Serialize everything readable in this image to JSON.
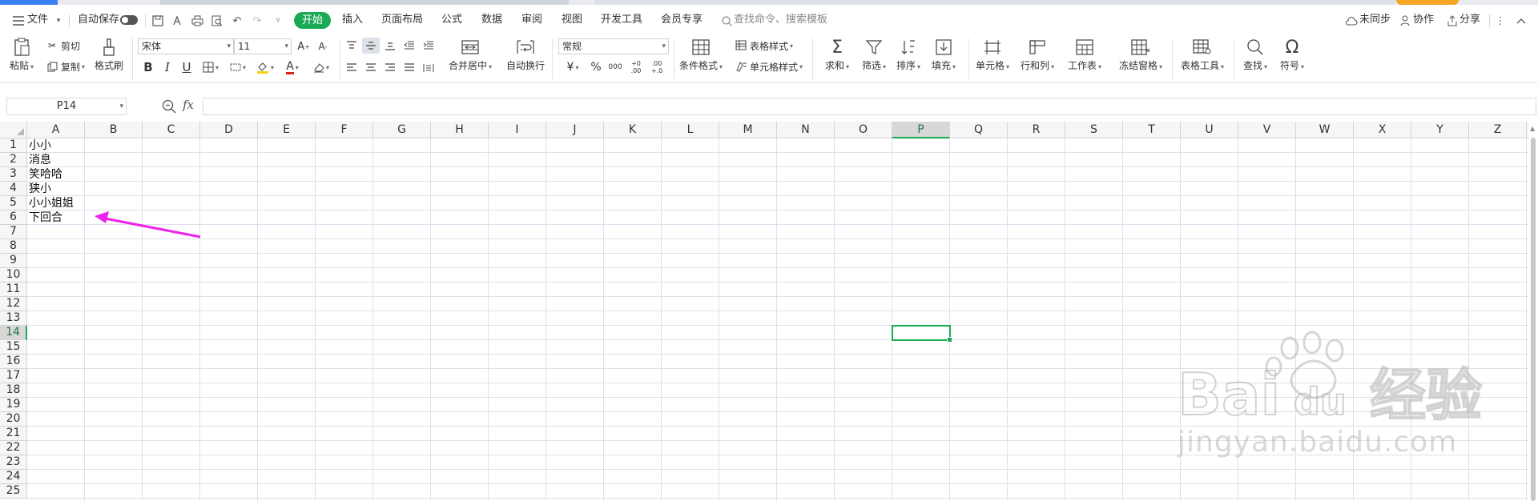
{
  "menubar": {
    "file_label": "文件",
    "autosave_label": "自动保存",
    "tabs": [
      "开始",
      "插入",
      "页面布局",
      "公式",
      "数据",
      "审阅",
      "视图",
      "开发工具",
      "会员专享"
    ],
    "search_placeholder": "查找命令、搜索模板",
    "sync_label": "未同步",
    "collab_label": "协作",
    "share_label": "分享"
  },
  "ribbon": {
    "paste": "粘贴",
    "cut": "剪切",
    "copy": "复制",
    "format_painter": "格式刷",
    "font_name": "宋体",
    "font_size": "11",
    "bold": "B",
    "italic": "I",
    "underline": "U",
    "merge_center": "合并居中",
    "wrap_text": "自动换行",
    "number_format": "常规",
    "currency": "¥",
    "percent": "%",
    "thousands": "000",
    "inc_decimal": "+0 .00",
    "dec_decimal": ".00 +.0",
    "cond_format": "条件格式",
    "table_style": "表格样式",
    "cell_style": "单元格样式",
    "sum": "求和",
    "filter": "筛选",
    "sort": "排序",
    "fill": "填充",
    "cell": "单元格",
    "row_col": "行和列",
    "worksheet": "工作表",
    "freeze": "冻结窗格",
    "table_tools": "表格工具",
    "find": "查找",
    "symbol": "符号"
  },
  "formula_bar": {
    "name_box": "P14",
    "fx": "fx",
    "content": ""
  },
  "sheet": {
    "columns": [
      "A",
      "B",
      "C",
      "D",
      "E",
      "F",
      "G",
      "H",
      "I",
      "J",
      "K",
      "L",
      "M",
      "N",
      "O",
      "P",
      "Q",
      "R",
      "S",
      "T",
      "U",
      "V",
      "W",
      "X",
      "Y",
      "Z"
    ],
    "rows": [
      "1",
      "2",
      "3",
      "4",
      "5",
      "6",
      "7",
      "8",
      "9",
      "10",
      "11",
      "12",
      "13",
      "14",
      "15",
      "16",
      "17",
      "18",
      "19",
      "20",
      "21",
      "22",
      "23",
      "24",
      "25"
    ],
    "cells_A": [
      "小小",
      "消息",
      "笑哈哈",
      "狭小",
      "小小姐姐",
      "下回合"
    ],
    "selected_cell": "P14",
    "selected_column": "P",
    "selected_row": "14"
  },
  "annotation": {
    "arrow_color": "#ee22ee"
  },
  "watermark": {
    "text": "jingyan.baidu.com",
    "logo": "Bai经验"
  },
  "colors": {
    "accent": "#1aaa55",
    "grid": "#dde0ec"
  }
}
